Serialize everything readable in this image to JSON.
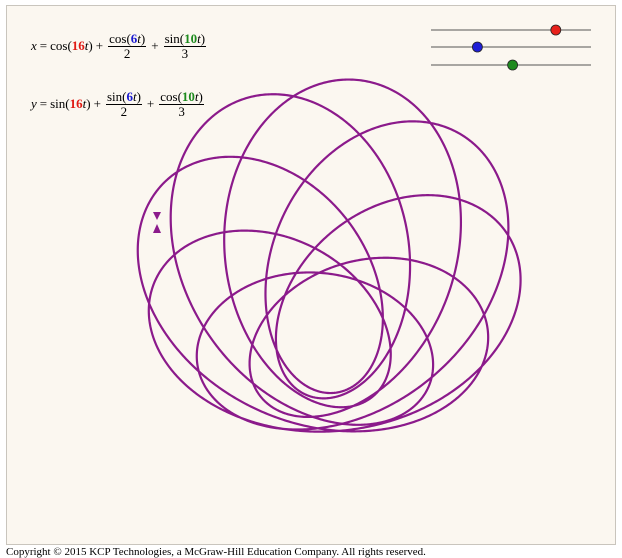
{
  "equations": {
    "x": {
      "lhs": "x",
      "eq": "=",
      "term1": "cos(",
      "term1_coef": "16",
      "term1_var": "t",
      "term1_close": ")",
      "plus1": "+",
      "frac1_num_fn": "cos(",
      "frac1_num_coef": "6",
      "frac1_num_var": "t",
      "frac1_num_close": ")",
      "frac1_den": "2",
      "plus2": "+",
      "frac2_num_fn": "sin(",
      "frac2_num_coef": "10",
      "frac2_num_var": "t",
      "frac2_num_close": ")",
      "frac2_den": "3"
    },
    "y": {
      "lhs": "y",
      "eq": "=",
      "term1": "sin(",
      "term1_coef": "16",
      "term1_var": "t",
      "term1_close": ")",
      "plus1": "+",
      "frac1_num_fn": "sin(",
      "frac1_num_coef": "6",
      "frac1_num_var": "t",
      "frac1_num_close": ")",
      "frac1_den": "2",
      "plus2": "+",
      "frac2_num_fn": "cos(",
      "frac2_num_coef": "10",
      "frac2_num_var": "t",
      "frac2_num_close": ")",
      "frac2_den": "3"
    }
  },
  "sliders": [
    {
      "name": "red-slider",
      "color": "#e8211b",
      "value": 0.78
    },
    {
      "name": "blue-slider",
      "color": "#1f1fd6",
      "value": 0.29
    },
    {
      "name": "green-slider",
      "color": "#1f8a1f",
      "value": 0.51
    }
  ],
  "curve": {
    "color": "#8b1a8b",
    "a": 16,
    "b": 6,
    "c": 10
  },
  "colors": {
    "red": "#e01b14",
    "blue": "#1a1ad0",
    "green": "#1d8a1d"
  },
  "copyright": "Copyright © 2015 KCP Technologies, a McGraw-Hill Education Company. All rights reserved."
}
